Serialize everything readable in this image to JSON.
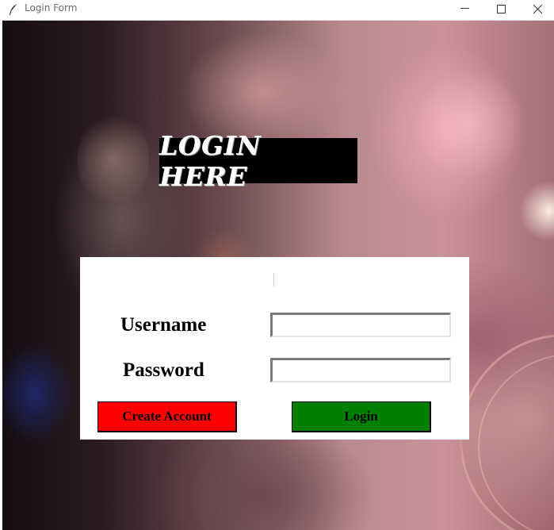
{
  "window": {
    "title": "Login Form",
    "app_icon": "feather-icon"
  },
  "colors": {
    "heading_bg": "#000000",
    "heading_text": "#ffffff",
    "create_button": "#ff0000",
    "login_button": "#008000",
    "panel_bg": "#ffffff"
  },
  "heading": {
    "text": "LOGIN HERE"
  },
  "form": {
    "username_label": "Username",
    "password_label": "Password",
    "username_value": "",
    "password_value": "",
    "create_account_label": "Create Account",
    "login_label": "Login"
  }
}
